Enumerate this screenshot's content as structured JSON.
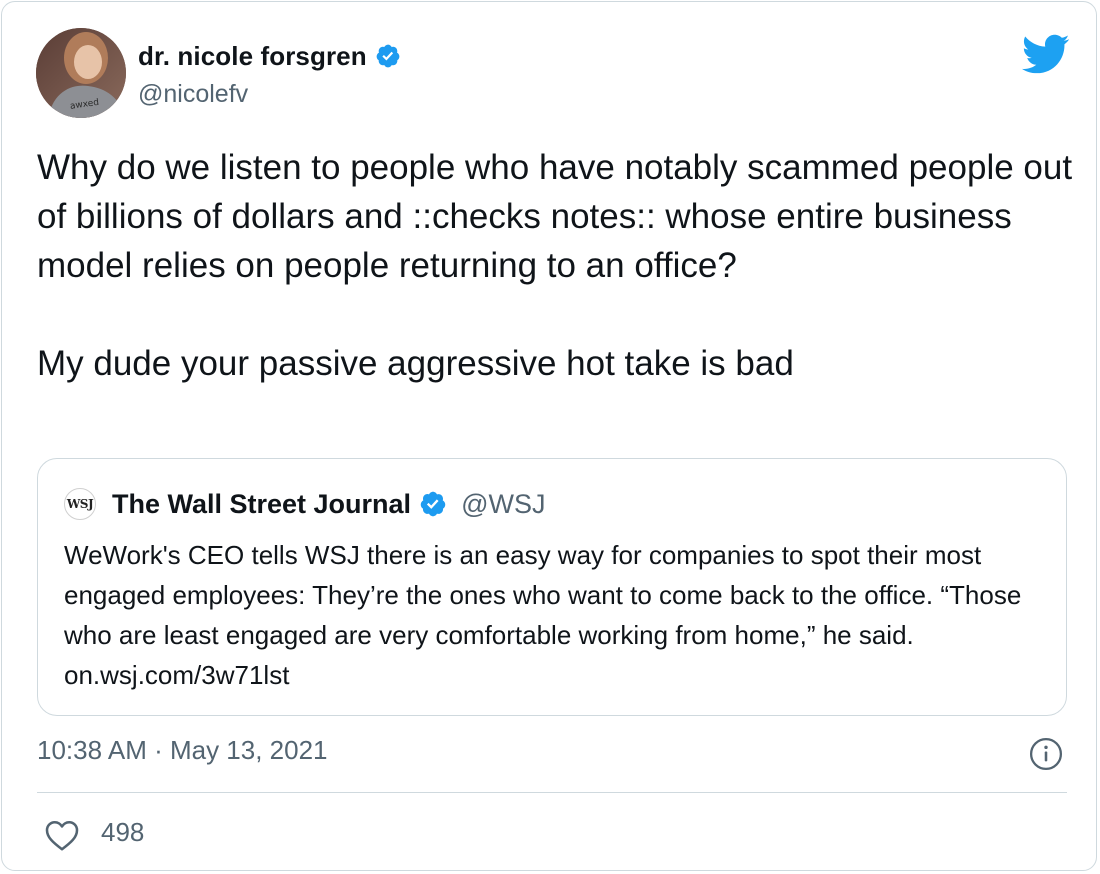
{
  "author": {
    "display_name": "dr. nicole forsgren",
    "handle": "@nicolefv"
  },
  "tweet": {
    "text": "Why do we listen to people who have notably scammed people out of billions of dollars and ::checks notes:: whose entire business model relies on people returning to an office?\n\nMy dude your passive aggressive hot take is bad"
  },
  "quoted_tweet": {
    "logo_text": "WSJ",
    "display_name": "The Wall Street Journal",
    "handle": "@WSJ",
    "text": "WeWork's CEO tells WSJ there is an easy way for companies to spot their most engaged employees: They’re the ones who want to come back to the office. “Those who are least engaged are very comfortable working from home,” he said. on.wsj.com/3w71lst"
  },
  "meta": {
    "timestamp": "10:38 AM · May 13, 2021"
  },
  "actions": {
    "like_count": "498"
  },
  "icons": {
    "verified": "verified-badge-icon",
    "brand": "twitter-bird-icon",
    "info": "info-icon",
    "like": "heart-icon"
  },
  "colors": {
    "verified_blue": "#1d9bf0",
    "brand_blue": "#1da1f2",
    "secondary_text": "#536471",
    "border": "#cfd9de"
  }
}
